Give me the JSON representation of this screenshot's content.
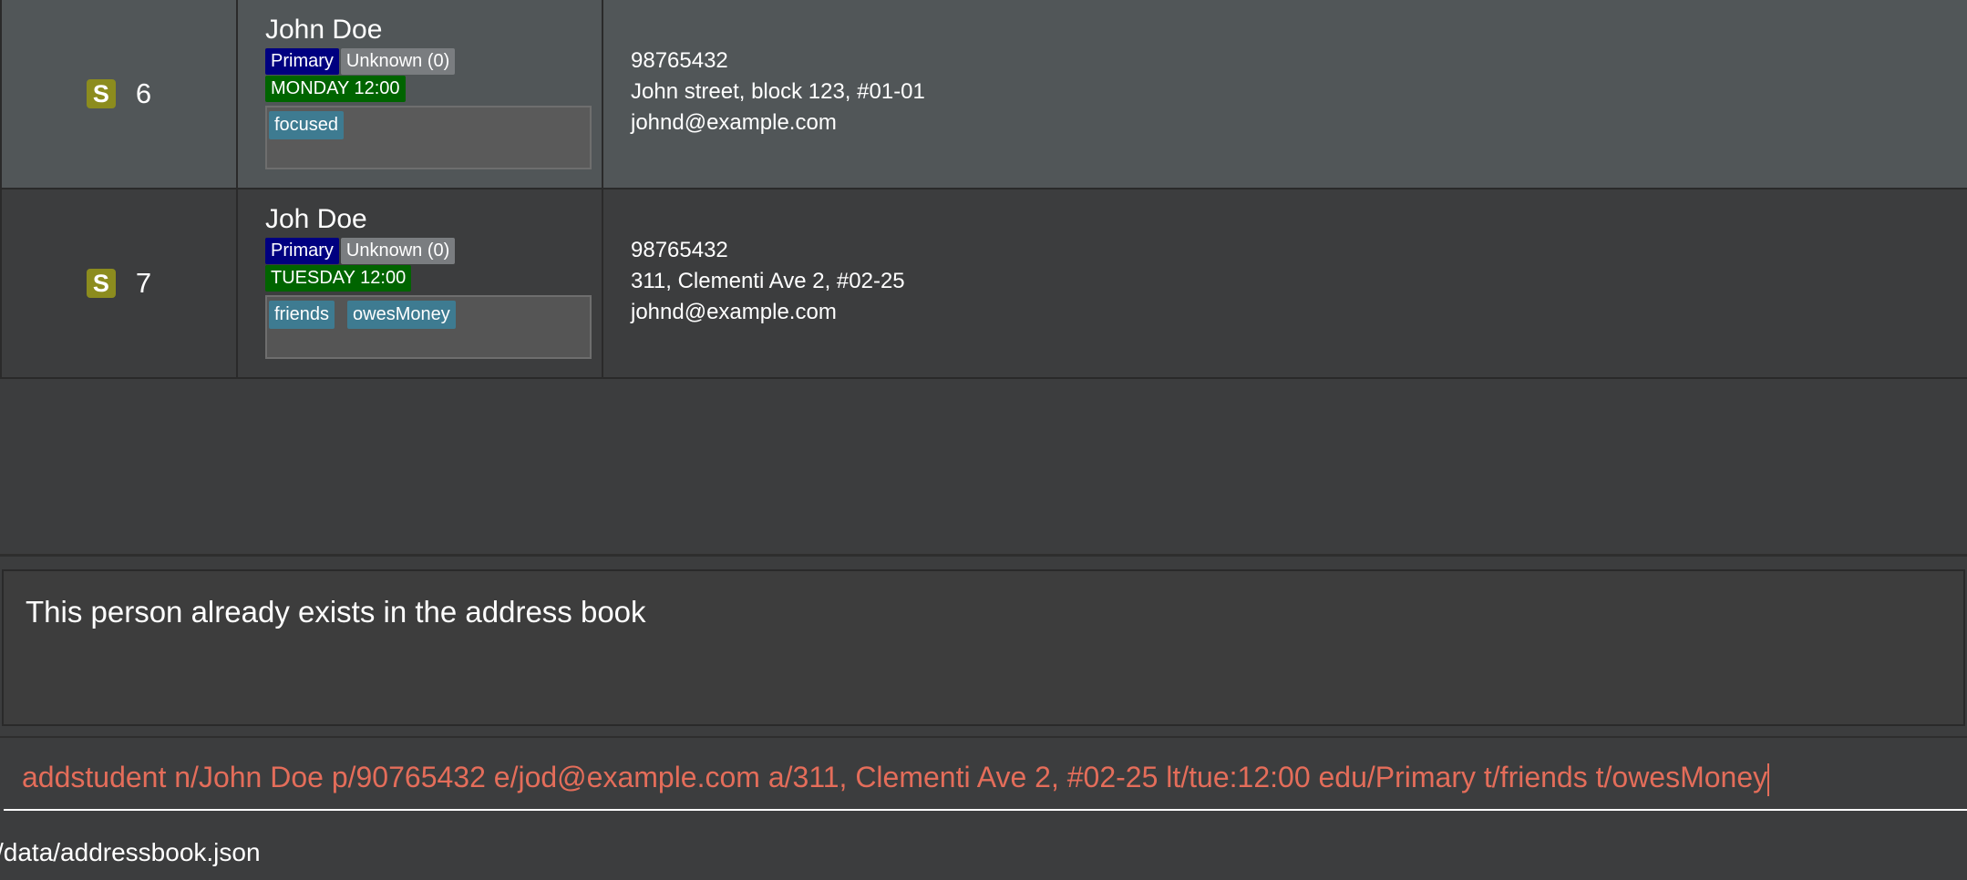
{
  "persons": [
    {
      "index": "6",
      "role": "S",
      "name": "John Doe",
      "education": "Primary",
      "grade": "Unknown (0)",
      "lesson": "MONDAY 12:00",
      "tags": [
        "focused"
      ],
      "phone": "98765432",
      "address": "John street, block 123, #01-01",
      "email": "johnd@example.com"
    },
    {
      "index": "7",
      "role": "S",
      "name": "Joh Doe",
      "education": "Primary",
      "grade": "Unknown (0)",
      "lesson": "TUESDAY 12:00",
      "tags": [
        "friends",
        "owesMoney"
      ],
      "phone": "98765432",
      "address": "311, Clementi Ave 2, #02-25",
      "email": "johnd@example.com"
    }
  ],
  "result": {
    "message": "This person already exists in the address book"
  },
  "command": {
    "value": "addstudent n/John Doe p/90765432 e/jod@example.com a/311, Clementi Ave 2, #02-25 lt/tue:12:00 edu/Primary t/friends t/owesMoney"
  },
  "status": {
    "path": "/data/addressbook.json"
  },
  "colors": {
    "role_badge": "#8c8c1e",
    "edu_tag": "#000080",
    "lesson_tag": "#006400",
    "tag": "#3e7b91",
    "command_text": "#e46d5a"
  }
}
